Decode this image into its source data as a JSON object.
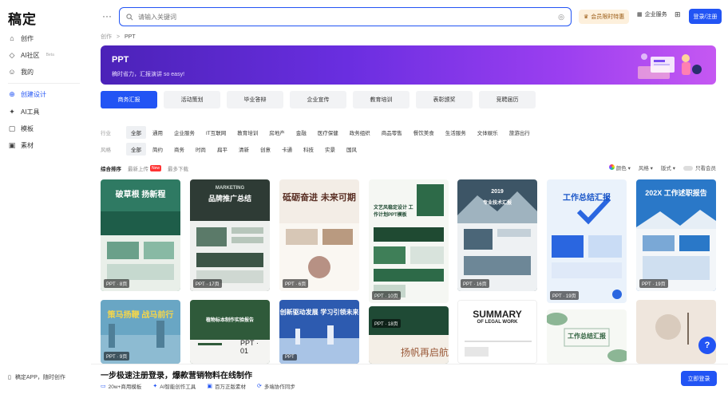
{
  "app": {
    "logo": "稿定"
  },
  "sidebar": {
    "items": [
      {
        "label": "创作",
        "icon": "home-icon"
      },
      {
        "label": "AI社区",
        "icon": "ai-community-icon",
        "beta": "Beta"
      },
      {
        "label": "我的",
        "icon": "user-icon"
      },
      {
        "label": "创建设计",
        "icon": "plus-circle-icon",
        "active": true
      },
      {
        "label": "AI工具",
        "icon": "ai-tool-icon"
      },
      {
        "label": "模板",
        "icon": "template-icon"
      },
      {
        "label": "素材",
        "icon": "material-icon"
      }
    ],
    "app_download": "稿定APP，随时创作"
  },
  "topbar": {
    "more": "···",
    "search_placeholder": "请输入关键词",
    "vip_label": "会员限时特惠",
    "enterprise_label": "企业服务",
    "login_label": "登录/注册"
  },
  "breadcrumb": {
    "root": "创作",
    "sep": ">",
    "current": "PPT"
  },
  "banner": {
    "title": "PPT",
    "subtitle": "稿时省力，汇报演讲 so easy!"
  },
  "categories": [
    "商务汇报",
    "活动策划",
    "毕业答辩",
    "企业宣传",
    "教育培训",
    "表彰颁奖",
    "竞聘届历"
  ],
  "filters": {
    "industry": {
      "label": "行业",
      "options": [
        "全部",
        "通用",
        "企业服务",
        "IT互联网",
        "教育培训",
        "房地产",
        "金融",
        "医疗保健",
        "政务组织",
        "商品零售",
        "餐饮美食",
        "生活服务",
        "文体娱乐",
        "旅游出行"
      ]
    },
    "style": {
      "label": "风格",
      "options": [
        "全部",
        "简约",
        "商务",
        "时尚",
        "扁平",
        "清新",
        "创意",
        "卡通",
        "科技",
        "实景",
        "国风"
      ]
    }
  },
  "sort": {
    "items": [
      "综合排序",
      "最新上传",
      "最多下载"
    ],
    "new_badge": "New",
    "right": {
      "color": "颜色",
      "style": "风格",
      "layout": "版式",
      "member_only": "只看会员"
    }
  },
  "templates": [
    {
      "title": "破草根 扬新程",
      "bg": "#2f7a63",
      "title_color": "#ffffff",
      "badge": "PPT · 8页"
    },
    {
      "title": "品牌推广总结",
      "sub": "MARKETING",
      "bg": "#2e3b35",
      "title_color": "#ffffff",
      "badge": "PPT · 17页"
    },
    {
      "title": "砥砺奋进 未来可期",
      "bg": "#f3ede6",
      "title_color": "#5a2f24",
      "badge": "PPT · 6页"
    },
    {
      "title": "文艺风稳定设计 工作计划PPT模板",
      "bg": "#f5f7f3",
      "title_color": "#1f4a32",
      "badge": "PPT · 10页"
    },
    {
      "title": "专业技术汇报",
      "sub": "2019",
      "bg": "#3d5566",
      "title_color": "#ffffff",
      "badge": "PPT · 16页"
    },
    {
      "title": "工作总结汇报",
      "bg": "#eaf2fb",
      "title_color": "#1a56c8",
      "badge": "PPT · 19页"
    },
    {
      "title": "202X 工作述职报告",
      "bg": "#2a78c8",
      "title_color": "#ffffff",
      "badge": "PPT · 19页"
    },
    {
      "title": "策马扬鞭 战马前行",
      "bg": "#69a6c4",
      "title_color": "#f5d64a",
      "badge": "PPT · 9页"
    },
    {
      "title": "植物标本制作实验报告",
      "bg": "#2f5a3a",
      "title_color": "#ffffff",
      "badge": "PPT · 01"
    },
    {
      "title": "创新驱动发展 学习引领未来",
      "bg": "#2d5bb0",
      "title_color": "#ffffff",
      "badge": "PPT"
    },
    {
      "title": "",
      "bg": "#1f4a35",
      "title_color": "#ffffff",
      "badge": "PPT · 18页"
    },
    {
      "title": "SUMMARY",
      "sub": "OF LEGAL WORK",
      "bg": "#ffffff",
      "title_color": "#222222",
      "badge": "PPT"
    },
    {
      "title": "工作总结汇报",
      "bg": "#f6f8f4",
      "title_color": "#2b5e3a",
      "badge": "PPT"
    },
    {
      "title": "",
      "bg": "#efe6dd",
      "title_color": "#444444",
      "badge": "PPT"
    }
  ],
  "bottom": {
    "title": "一步极速注册登录，爆款营销物料在线制作",
    "features": [
      "20w+商用模板",
      "AI智能创作工具",
      "百万正版素材",
      "多端协作同步"
    ],
    "cta": "立即登录"
  },
  "help": "?"
}
